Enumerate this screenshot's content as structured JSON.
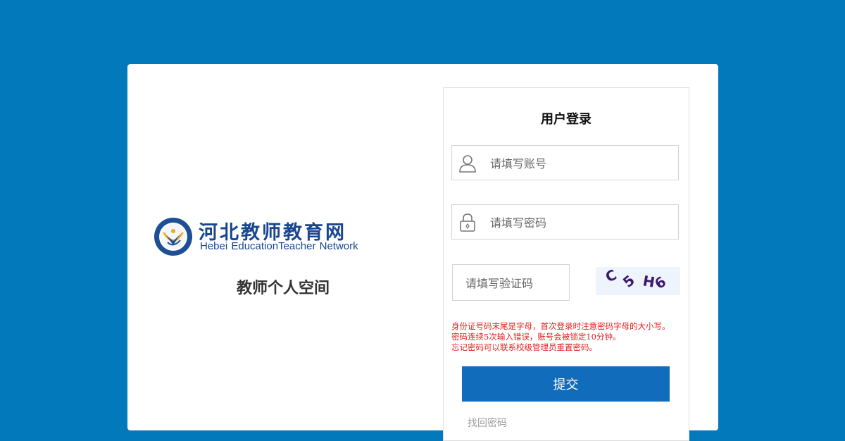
{
  "brand": {
    "name_cn": "河北教师教育网",
    "name_en": "Hebei EducationTeacher  Network",
    "subtitle": "教师个人空间",
    "color": "#17468f"
  },
  "login": {
    "title": "用户登录",
    "username_placeholder": "请填写账号",
    "password_placeholder": "请填写密码",
    "captcha_placeholder": "请填写验证码",
    "captcha_text": "C5H6",
    "notice_lines": [
      "身份证号码末尾是字母，首次登录时注意密码字母的大小写。",
      "密码连续5次输入错误，账号会被锁定10分钟。",
      "忘记密码可以联系校级管理员重置密码。"
    ],
    "submit_label": "提交",
    "forgot_label": "找回密码"
  },
  "colors": {
    "background": "#0279bb",
    "primary_button": "#126cbc",
    "notice": "#e02020"
  },
  "icons": {
    "username": "user-icon",
    "password": "lock-icon"
  }
}
